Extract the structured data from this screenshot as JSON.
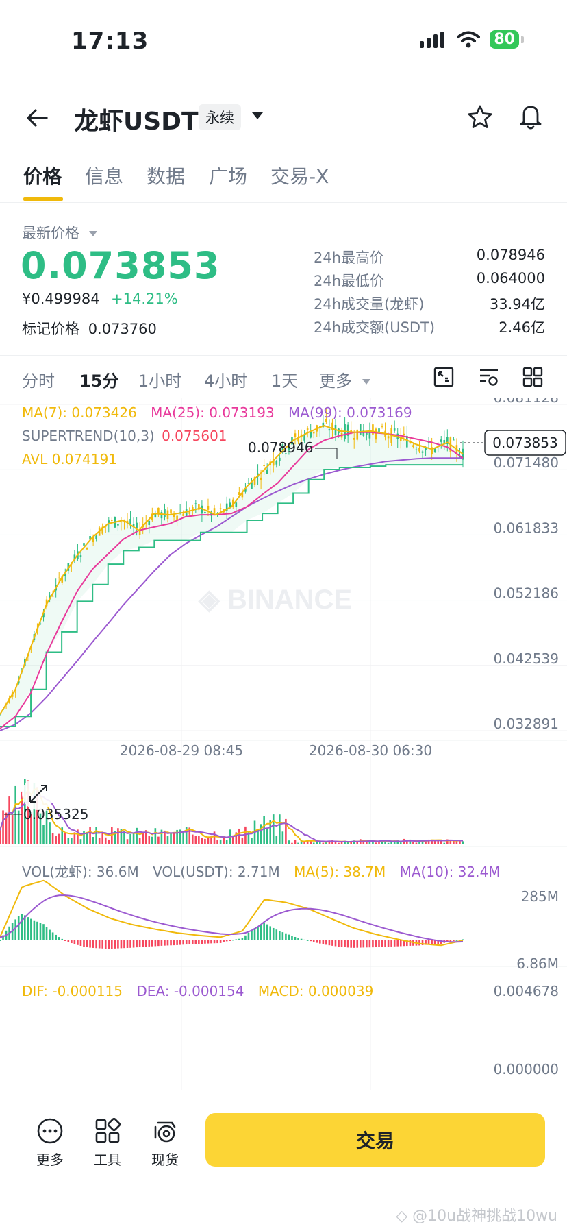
{
  "status_bar": {
    "time": "17:13",
    "battery": "80"
  },
  "header": {
    "title": "龙虾USDT",
    "tag": "永续"
  },
  "tabs": [
    "价格",
    "信息",
    "数据",
    "广场",
    "交易-X"
  ],
  "price": {
    "label": "最新价格",
    "last": "0.073853",
    "cny": "¥0.499984",
    "change": "+14.21%",
    "mark_label": "标记价格",
    "mark_value": "0.073760"
  },
  "stats": [
    {
      "label": "24h最高价",
      "value": "0.078946"
    },
    {
      "label": "24h最低价",
      "value": "0.064000"
    },
    {
      "label": "24h成交量(龙虾)",
      "value": "33.94亿"
    },
    {
      "label": "24h成交额(USDT)",
      "value": "2.46亿"
    }
  ],
  "intervals": [
    "分时",
    "15分",
    "1小时",
    "4小时",
    "1天",
    "更多"
  ],
  "indicators": {
    "ma7": "MA(7): 0.073426",
    "ma25": "MA(25): 0.073193",
    "ma99": "MA(99): 0.073169",
    "supertrend_label": "SUPERTREND(10,3)",
    "supertrend_value": "0.075601",
    "avl": "AVL 0.074191",
    "high_marker": "0.078946",
    "low_marker": "0.035325",
    "current_price_tag": "0.073853"
  },
  "colors": {
    "up": "#2ebd85",
    "down": "#f6465d",
    "ma7": "#f0b90b",
    "ma25": "#e8399b",
    "ma99": "#9b59d0",
    "accent": "#fcd535"
  },
  "volume": {
    "vol_base": "VOL(龙虾): 36.6M",
    "vol_quote": "VOL(USDT): 2.71M",
    "ma5": "MA(5): 38.7M",
    "ma10": "MA(10): 32.4M",
    "axis_top": "285M",
    "axis_bottom": "6.86M"
  },
  "macd": {
    "dif": "DIF: -0.000115",
    "dea": "DEA: -0.000154",
    "macd": "MACD: 0.000039",
    "axis_top": "0.004678",
    "axis_zero": "0.000000"
  },
  "chart_data": {
    "type": "line",
    "title": "",
    "y_axis_ticks": [
      "0.081128",
      "0.071480",
      "0.061833",
      "0.052186",
      "0.042539",
      "0.032891"
    ],
    "x_axis_ticks": [
      "2026-08-29 08:45",
      "2026-08-30 06:30"
    ],
    "ylim": [
      0.032891,
      0.081128
    ],
    "grid": true,
    "series": [
      {
        "name": "MA(7)",
        "values": [
          0.0353,
          0.039,
          0.0453,
          0.0515,
          0.0555,
          0.0588,
          0.0615,
          0.0635,
          0.064,
          0.0625,
          0.065,
          0.0648,
          0.0652,
          0.0658,
          0.0648,
          0.066,
          0.069,
          0.0712,
          0.0735,
          0.0758,
          0.077,
          0.078,
          0.0772,
          0.077,
          0.0772,
          0.0768,
          0.0762,
          0.0752,
          0.0745,
          0.0755,
          0.0738
        ]
      },
      {
        "name": "MA(25)",
        "values": [
          0.0332,
          0.035,
          0.0385,
          0.0442,
          0.049,
          0.0535,
          0.0568,
          0.059,
          0.0612,
          0.0625,
          0.063,
          0.0635,
          0.0645,
          0.0648,
          0.0648,
          0.065,
          0.066,
          0.0678,
          0.0695,
          0.072,
          0.0745,
          0.0758,
          0.0765,
          0.077,
          0.077,
          0.0768,
          0.0765,
          0.076,
          0.0755,
          0.0748,
          0.0732
        ]
      },
      {
        "name": "MA(99)",
        "values": [
          0.0329,
          0.0338,
          0.0355,
          0.0378,
          0.0405,
          0.0432,
          0.046,
          0.0487,
          0.0515,
          0.054,
          0.0565,
          0.0588,
          0.0605,
          0.0618,
          0.063,
          0.0645,
          0.066,
          0.0672,
          0.0683,
          0.0693,
          0.0701,
          0.0708,
          0.0714,
          0.0719,
          0.0723,
          0.0727,
          0.0729,
          0.0731,
          0.0732,
          0.0732,
          0.0732
        ]
      },
      {
        "name": "SUPERTREND(10,3)",
        "values": [
          0.0335,
          0.035,
          0.039,
          0.0445,
          0.0475,
          0.052,
          0.0545,
          0.0575,
          0.0595,
          0.06,
          0.061,
          0.061,
          0.061,
          0.0622,
          0.0622,
          0.0622,
          0.064,
          0.065,
          0.0665,
          0.068,
          0.07,
          0.0715,
          0.0718,
          0.0718,
          0.072,
          0.0722,
          0.0722,
          0.0722,
          0.0722,
          0.0722,
          0.0722
        ]
      }
    ]
  }
}
